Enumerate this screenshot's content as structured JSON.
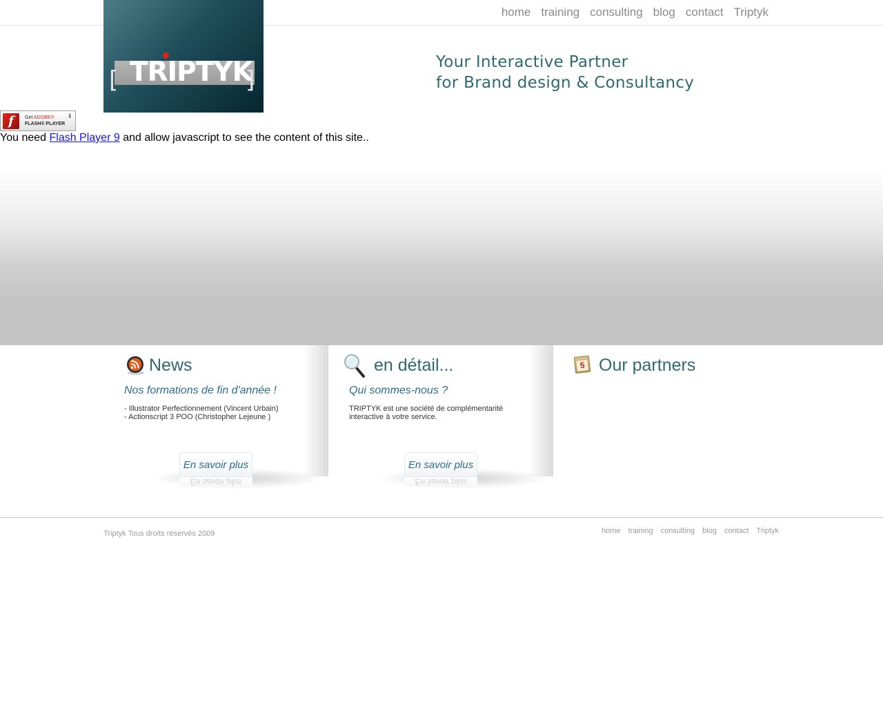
{
  "header": {
    "logo_text": "TRIPTYK",
    "nav": [
      "home",
      "training",
      "consulting",
      "blog",
      "contact",
      "Triptyk"
    ],
    "tagline_line1": "Your Interactive Partner",
    "tagline_line2": "for Brand design & Consultancy"
  },
  "flash": {
    "badge_line1_prefix": "Get ",
    "badge_line1_brand": "ADOBE®",
    "badge_line2": "FLASH® PLAYER",
    "notice_before": "You need ",
    "notice_link": "Flash Player 9",
    "notice_after": " and allow javascript to see the content of this site.."
  },
  "columns": [
    {
      "heading": "News",
      "subtitle": "Nos formations de fin d'année !",
      "lines": [
        "- Illustrator Perfectionnement (Vincent Urbain)",
        "- Actionscript 3 POO (Christopher Lejeune )"
      ],
      "more_label": "En savoir plus",
      "icon": "rss-icon"
    },
    {
      "heading": "en détail...",
      "subtitle": "Qui sommes-nous ?",
      "lines": [
        "TRIPTYK est une société de complémentarité",
        "interactive à votre service."
      ],
      "more_label": "En savoir plus",
      "icon": "magnifier-icon"
    },
    {
      "heading": "Our partners",
      "icon": "calendar-icon",
      "icon_text": "5"
    }
  ],
  "footer": {
    "copyright": "Triptyk Tous droits réservés 2009",
    "nav": [
      "home",
      "training",
      "consulting",
      "blog",
      "contact",
      "Triptyk"
    ]
  },
  "colors": {
    "accent_teal": "#2f6a6d",
    "link_blue": "#2e6c8f",
    "nav_gray": "#8a8a8a"
  }
}
